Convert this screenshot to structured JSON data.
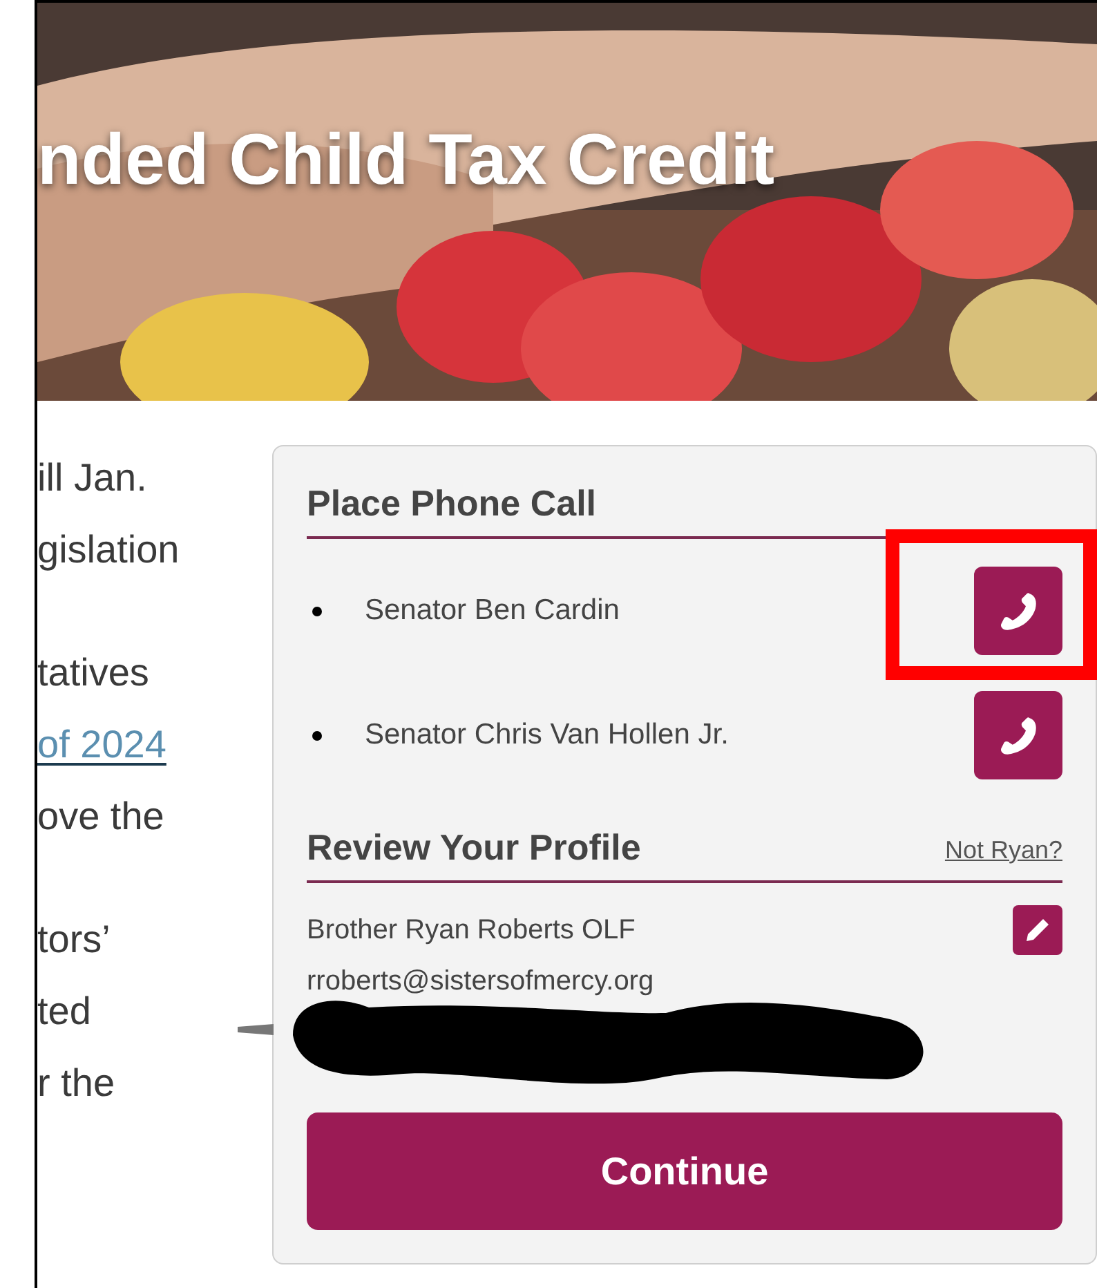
{
  "hero": {
    "title": "nded Child Tax Credit",
    "kind": "picture"
  },
  "article": {
    "paragraphs": [
      [
        {
          "text": "ill Jan.",
          "kind": "text"
        },
        {
          "text": "gislation",
          "kind": "text"
        }
      ],
      [
        {
          "text": "tatives",
          "kind": "text"
        },
        {
          "text": "of 2024",
          "kind": "link"
        },
        {
          "text": "ove the",
          "kind": "text"
        }
      ],
      [
        {
          "text": "tors’",
          "kind": "text"
        },
        {
          "text": "ted",
          "kind": "text"
        },
        {
          "text": "r the",
          "kind": "text"
        }
      ]
    ]
  },
  "panel": {
    "call_section": {
      "heading": "Place Phone Call",
      "targets": [
        {
          "name": "Senator Ben Cardin",
          "highlighted": true
        },
        {
          "name": "Senator Chris Van Hollen Jr.",
          "highlighted": false
        }
      ]
    },
    "profile": {
      "heading": "Review Your Profile",
      "switch_link": "Not Ryan?",
      "name": "Brother Ryan Roberts OLF",
      "email": "rroberts@sistersofmercy.org",
      "redacted": true
    },
    "continue_button": "Continue"
  }
}
